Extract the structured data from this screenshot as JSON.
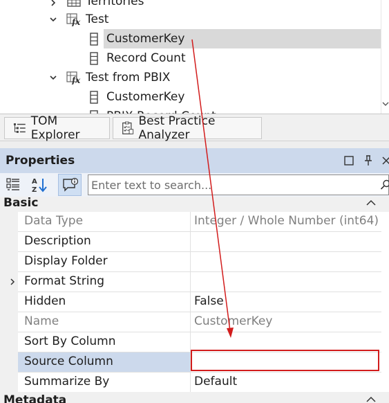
{
  "tree": {
    "items": [
      {
        "label": "Territories",
        "level": 1,
        "expanded": false,
        "icon": "table-icon"
      },
      {
        "label": "Test",
        "level": 1,
        "expanded": true,
        "icon": "calculated-table-icon"
      },
      {
        "label": "CustomerKey",
        "level": 2,
        "icon": "column-icon",
        "selected": true
      },
      {
        "label": "Record Count",
        "level": 2,
        "icon": "column-icon"
      },
      {
        "label": "Test from PBIX",
        "level": 1,
        "expanded": true,
        "icon": "calculated-table-icon"
      },
      {
        "label": "CustomerKey",
        "level": 2,
        "icon": "column-icon"
      },
      {
        "label": "PBIX Record Count",
        "level": 2,
        "icon": "column-icon"
      }
    ]
  },
  "tabs": [
    {
      "label": "TOM Explorer",
      "icon": "tree-list-icon"
    },
    {
      "label": "Best Practice Analyzer",
      "icon": "checklist-icon"
    }
  ],
  "properties": {
    "title": "Properties",
    "search_placeholder": "Enter text to search...",
    "section": "Basic",
    "next_section": "Metadata",
    "rows": [
      {
        "name": "Data Type",
        "value": "Integer / Whole Number (int64)",
        "readonly": true
      },
      {
        "name": "Description",
        "value": ""
      },
      {
        "name": "Display Folder",
        "value": ""
      },
      {
        "name": "Format String",
        "value": "",
        "expandable": true
      },
      {
        "name": "Hidden",
        "value": "False"
      },
      {
        "name": "Name",
        "value": "CustomerKey",
        "readonly": true
      },
      {
        "name": "Sort By Column",
        "value": ""
      },
      {
        "name": "Source Column",
        "value": "",
        "selected": true
      },
      {
        "name": "Summarize By",
        "value": "Default"
      }
    ]
  },
  "colors": {
    "accent": "#ccd9ec",
    "selection": "#d9d9d9",
    "annotation": "#d21c1c"
  }
}
